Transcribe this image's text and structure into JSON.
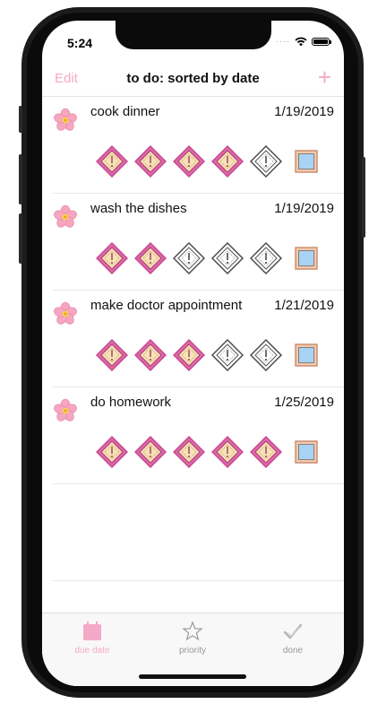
{
  "status_bar": {
    "time": "5:24",
    "signal": "····"
  },
  "nav": {
    "edit_label": "Edit",
    "title": "to do: sorted by date",
    "add_label": "+"
  },
  "tasks": [
    {
      "title": "cook dinner",
      "date": "1/19/2019",
      "priority": 4,
      "done": false
    },
    {
      "title": "wash the dishes",
      "date": "1/19/2019",
      "priority": 2,
      "done": false
    },
    {
      "title": "make doctor appointment",
      "date": "1/21/2019",
      "priority": 3,
      "done": false
    },
    {
      "title": "do homework",
      "date": "1/25/2019",
      "priority": 5,
      "done": false
    }
  ],
  "tabs": [
    {
      "label": "due date",
      "icon": "calendar-icon",
      "active": true
    },
    {
      "label": "priority",
      "icon": "star-icon",
      "active": false
    },
    {
      "label": "done",
      "icon": "checkmark-icon",
      "active": false
    }
  ],
  "colors": {
    "accent": "#f5a9c8",
    "diamond_on_fill": "#f6e3b4",
    "diamond_on_border": "#c9468f",
    "checkbox_fill": "#a9d3f5",
    "checkbox_border": "#c98a6a",
    "tab_inactive": "#9a9a9a"
  }
}
